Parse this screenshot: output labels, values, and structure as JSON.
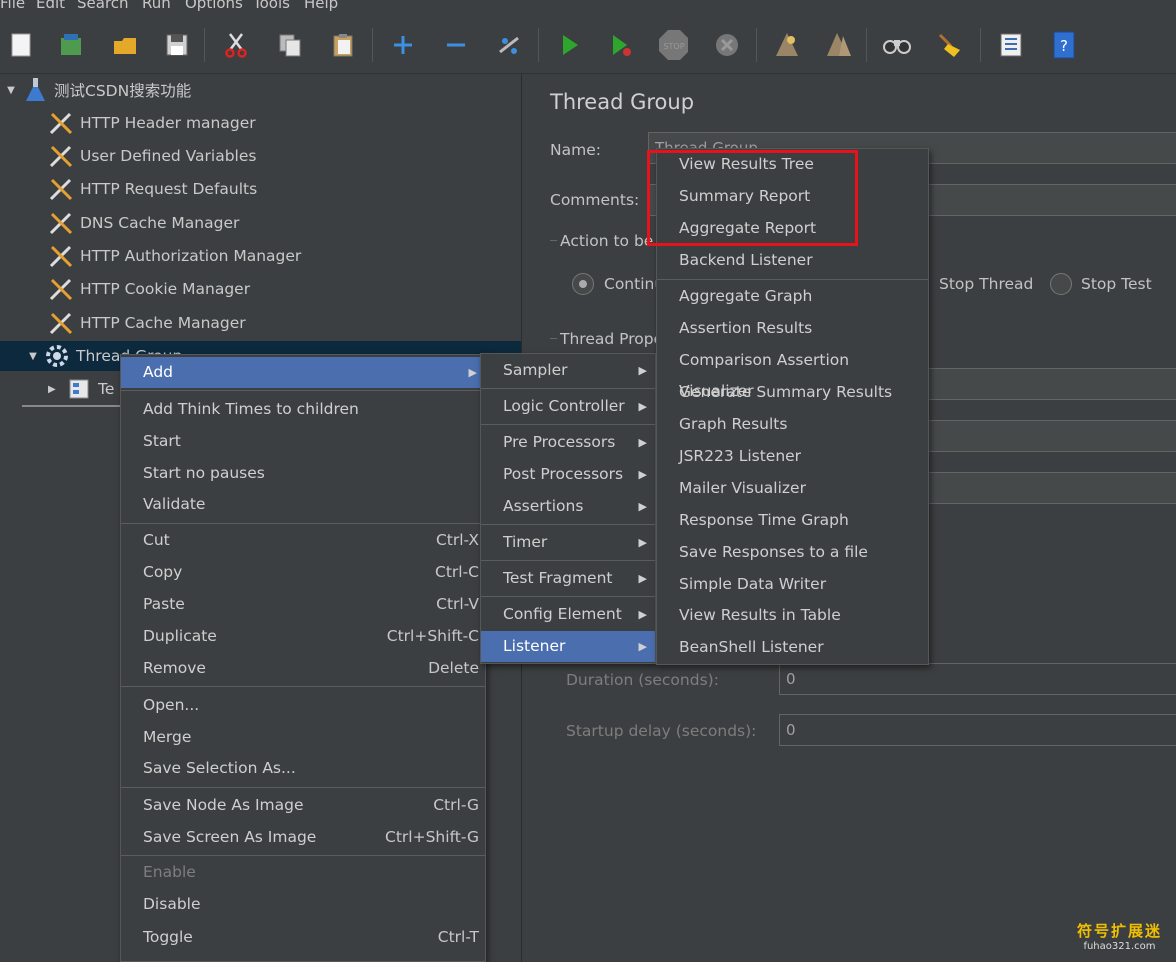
{
  "menubar": {
    "items": [
      "File",
      "Edit",
      "Search",
      "Run",
      "Options",
      "Tools",
      "Help"
    ]
  },
  "toolbar": {
    "buttons": [
      "new-icon",
      "templates-icon",
      "open-icon",
      "save-icon",
      "cut-icon",
      "copy-icon",
      "paste-icon",
      "expand-icon",
      "collapse-icon",
      "toggle-icon",
      "start-icon",
      "start-no-pauses-icon",
      "stop-icon",
      "shutdown-icon",
      "clear-icon",
      "clear-all-icon",
      "search-icon",
      "reset-search-icon",
      "function-helper-icon",
      "help-icon"
    ]
  },
  "tree": {
    "root": "测试CSDN搜索功能",
    "items": [
      "HTTP Header manager",
      "User Defined Variables",
      "HTTP Request Defaults",
      "DNS Cache Manager",
      "HTTP Authorization Manager",
      "HTTP Cookie Manager",
      "HTTP Cache Manager"
    ],
    "thread_group": "Thread Group",
    "child_partial": "Te"
  },
  "panel": {
    "title": "Thread Group",
    "name_label": "Name:",
    "name_value": "Thread Group",
    "comments_label": "Comments:",
    "action_label": "Action to be",
    "continue_label": "Continu",
    "stop_thread_label": "Stop Thread",
    "stop_test_label": "Stop Test",
    "thread_props_label": "Thread Prope",
    "duration_label": "Duration (seconds):",
    "duration_value": "0",
    "startup_label": "Startup delay (seconds):",
    "startup_value": "0"
  },
  "context_menu": {
    "add": "Add",
    "add_think": "Add Think Times to children",
    "start": "Start",
    "start_no_pauses": "Start no pauses",
    "validate": "Validate",
    "cut": "Cut",
    "cut_acc": "Ctrl-X",
    "copy": "Copy",
    "copy_acc": "Ctrl-C",
    "paste": "Paste",
    "paste_acc": "Ctrl-V",
    "duplicate": "Duplicate",
    "duplicate_acc": "Ctrl+Shift-C",
    "remove": "Remove",
    "remove_acc": "Delete",
    "open": "Open...",
    "merge": "Merge",
    "save_selection": "Save Selection As...",
    "save_node_image": "Save Node As Image",
    "save_node_image_acc": "Ctrl-G",
    "save_screen_image": "Save Screen As Image",
    "save_screen_image_acc": "Ctrl+Shift-G",
    "enable": "Enable",
    "disable": "Disable",
    "toggle": "Toggle",
    "toggle_acc": "Ctrl-T"
  },
  "add_submenu": {
    "sampler": "Sampler",
    "logic_controller": "Logic Controller",
    "pre_processors": "Pre Processors",
    "post_processors": "Post Processors",
    "assertions": "Assertions",
    "timer": "Timer",
    "test_fragment": "Test Fragment",
    "config_element": "Config Element",
    "listener": "Listener"
  },
  "listener_submenu": {
    "items": [
      "View Results Tree",
      "Summary Report",
      "Aggregate Report",
      "Backend Listener",
      "Aggregate Graph",
      "Assertion Results",
      "Comparison Assertion Visualizer",
      "Generate Summary Results",
      "Graph Results",
      "JSR223 Listener",
      "Mailer Visualizer",
      "Response Time Graph",
      "Save Responses to a file",
      "Simple Data Writer",
      "View Results in Table",
      "BeanShell Listener"
    ]
  },
  "watermark": {
    "line1": "符号扩展迷",
    "line2": "fuhao321.com"
  },
  "colors": {
    "background": "#3c3f41",
    "highlight": "#4b6eaf",
    "selected_row": "#0d293e",
    "annotation_box": "#e8121c"
  }
}
